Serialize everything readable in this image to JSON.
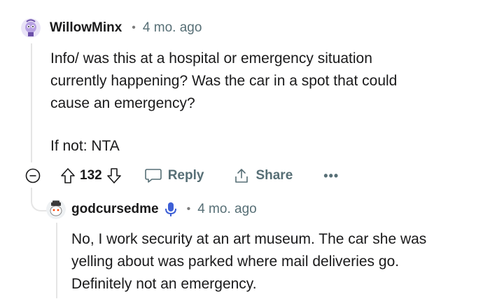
{
  "comment": {
    "username": "WillowMinx",
    "time": "4 mo. ago",
    "body_lines": [
      "Info/ was this at a hospital or emergency situation",
      "currently happening? Was the car in a spot that could",
      "cause an emergency?"
    ],
    "body_verdict": "If not: NTA",
    "votes": "132",
    "reply_label": "Reply",
    "share_label": "Share",
    "more_label": "•••"
  },
  "reply": {
    "username": "godcursedme",
    "time": "4 mo. ago",
    "body_lines": [
      "No, I work security at an art museum. The car she was",
      "yelling about was parked where mail deliveries go.",
      "Definitely not an emergency."
    ]
  },
  "colors": {
    "text": "#1a1a1b",
    "meta": "#576f76",
    "thread_line": "#e5e5e5",
    "avatar_primary": "#b8a2e3"
  },
  "icons": {
    "collapse": "minus-circle-icon",
    "upvote": "arrow-up-outline-icon",
    "downvote": "arrow-down-outline-icon",
    "reply": "speech-bubble-icon",
    "share": "share-upload-icon",
    "verified": "microphone-badge-icon"
  }
}
